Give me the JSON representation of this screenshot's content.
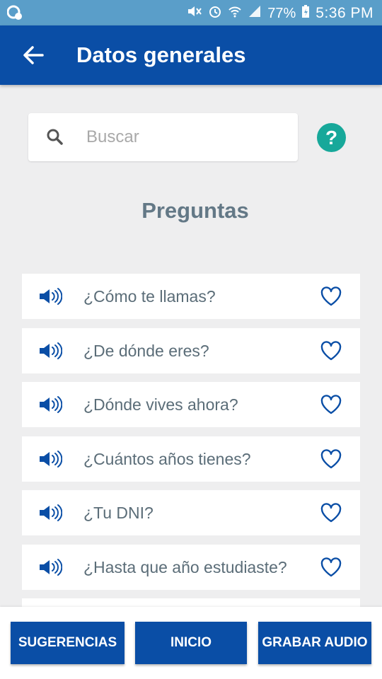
{
  "status_bar": {
    "battery": "77%",
    "time": "5:36 PM"
  },
  "app_bar": {
    "title": "Datos generales"
  },
  "search": {
    "placeholder": "Buscar",
    "value": ""
  },
  "help": {
    "label": "?"
  },
  "section": {
    "title": "Preguntas"
  },
  "questions": [
    {
      "label": "¿Cómo te llamas?"
    },
    {
      "label": "¿De dónde eres?"
    },
    {
      "label": "¿Dónde vives ahora?"
    },
    {
      "label": "¿Cuántos años tienes?"
    },
    {
      "label": "¿Tu DNI?"
    },
    {
      "label": "¿Hasta que año estudiaste?"
    }
  ],
  "bottom_bar": {
    "suggestions_label": "SUGERENCIAS",
    "home_label": "INICIO",
    "record_label": "GRABAR AUDIO"
  },
  "colors": {
    "primary": "#0a4ea6",
    "status_bar": "#5a9ec9",
    "help": "#17a89a",
    "text_muted": "#637886"
  },
  "icons": {
    "back": "arrow-left-icon",
    "search": "search-icon",
    "speaker": "speaker-icon",
    "heart": "heart-outline-icon"
  }
}
